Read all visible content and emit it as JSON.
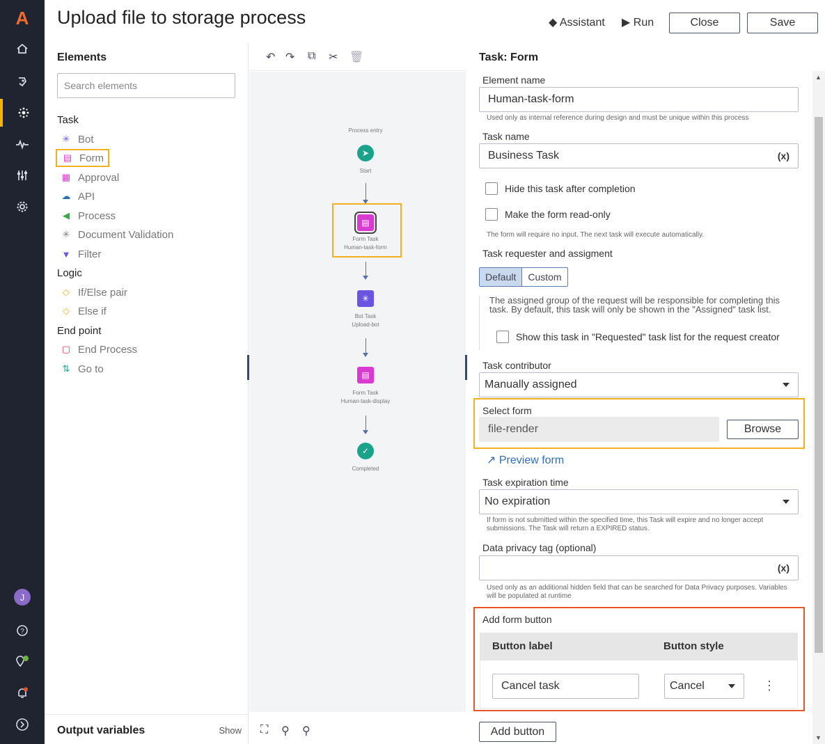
{
  "header": {
    "title": "Upload file to storage process",
    "assistant_label": "Assistant",
    "run_label": "Run",
    "close_label": "Close",
    "save_label": "Save"
  },
  "rail": {
    "logo": "A",
    "avatar_initial": "J",
    "icons": [
      "home-icon",
      "bot-icon",
      "automation-icon",
      "activity-icon",
      "sliders-icon",
      "gear-icon",
      "help-icon",
      "location-icon",
      "bell-icon",
      "expand-icon"
    ]
  },
  "elements": {
    "title": "Elements",
    "search_placeholder": "Search elements",
    "sections": {
      "task": "Task",
      "logic": "Logic",
      "end_point": "End point"
    },
    "task_items": [
      "Bot",
      "Form",
      "Approval",
      "API",
      "Process",
      "Document Validation",
      "Filter"
    ],
    "logic_items": [
      "If/Else pair",
      "Else if"
    ],
    "end_items": [
      "End Process",
      "Go to"
    ],
    "output_variables": "Output variables",
    "show": "Show"
  },
  "canvas": {
    "process_entry": "Process entry",
    "start": "Start",
    "node1_type": "Form Task",
    "node1_name": "Human-task-form",
    "node2_type": "Bot Task",
    "node2_name": "Upload-bot",
    "node3_type": "Form Task",
    "node3_name": "Human-task-display",
    "completed": "Completed"
  },
  "props": {
    "title": "Task: Form",
    "element_name_label": "Element name",
    "element_name_value": "Human-task-form",
    "element_name_help": "Used only as internal reference during design and must be unique within this process",
    "task_name_label": "Task name",
    "task_name_value": "Business Task",
    "var_tag": "(x)",
    "hide_task": "Hide this task after completion",
    "read_only": "Make the form read-only",
    "read_only_help": "The form will require no input. The next task will execute automatically.",
    "requester_label": "Task requester and assigment",
    "seg_default": "Default",
    "seg_custom": "Custom",
    "assign_text": "The assigned group of the request will be responsible for completing this task. By default, this task will only be shown in the \"Assigned\" task list.",
    "show_requested": "Show this task in \"Requested\" task list for the request creator",
    "contributor_label": "Task contributor",
    "contributor_value": "Manually assigned",
    "select_form_label": "Select form",
    "select_form_value": "file-render",
    "browse": "Browse",
    "preview_form": "Preview form",
    "expiration_label": "Task expiration time",
    "expiration_value": "No expiration",
    "expiration_help": "If form is not submitted within the specified time, this Task will expire and no longer accept submissions. The Task will return a EXPIRED status.",
    "privacy_label": "Data privacy tag (optional)",
    "privacy_help": "Used only as an additional hidden field that can be searched for Data Privacy purposes. Variables will be populated at runtime",
    "add_form_button_label": "Add form button",
    "col_button_label": "Button label",
    "col_button_style": "Button style",
    "row_label_value": "Cancel task",
    "row_style_value": "Cancel",
    "add_button": "Add button"
  }
}
